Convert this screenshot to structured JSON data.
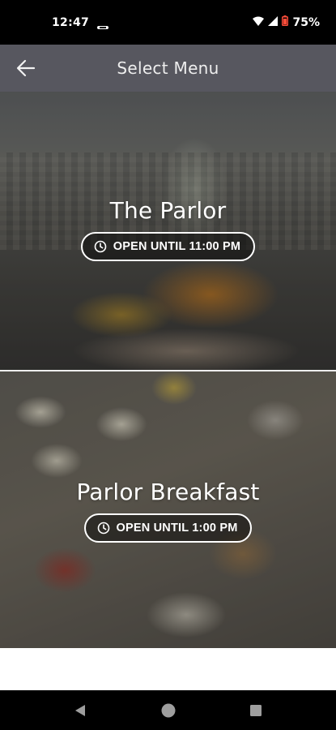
{
  "status_bar": {
    "time": "12:47",
    "battery": "75%",
    "icons": [
      "notification-icon",
      "wifi-icon",
      "signal-icon",
      "battery-icon"
    ]
  },
  "header": {
    "title": "Select Menu",
    "back_icon": "arrow-left-icon"
  },
  "menus": [
    {
      "title": "The Parlor",
      "hours": "OPEN UNTIL 11:00 PM",
      "icon": "clock-icon"
    },
    {
      "title": "Parlor Breakfast",
      "hours": "OPEN UNTIL 1:00 PM",
      "icon": "clock-icon"
    }
  ],
  "nav_bar": {
    "buttons": [
      "back-triangle-icon",
      "home-circle-icon",
      "recents-square-icon"
    ]
  },
  "colors": {
    "header_bg": "#57575f",
    "status_bg": "#000000",
    "badge_border": "#ffffff"
  }
}
